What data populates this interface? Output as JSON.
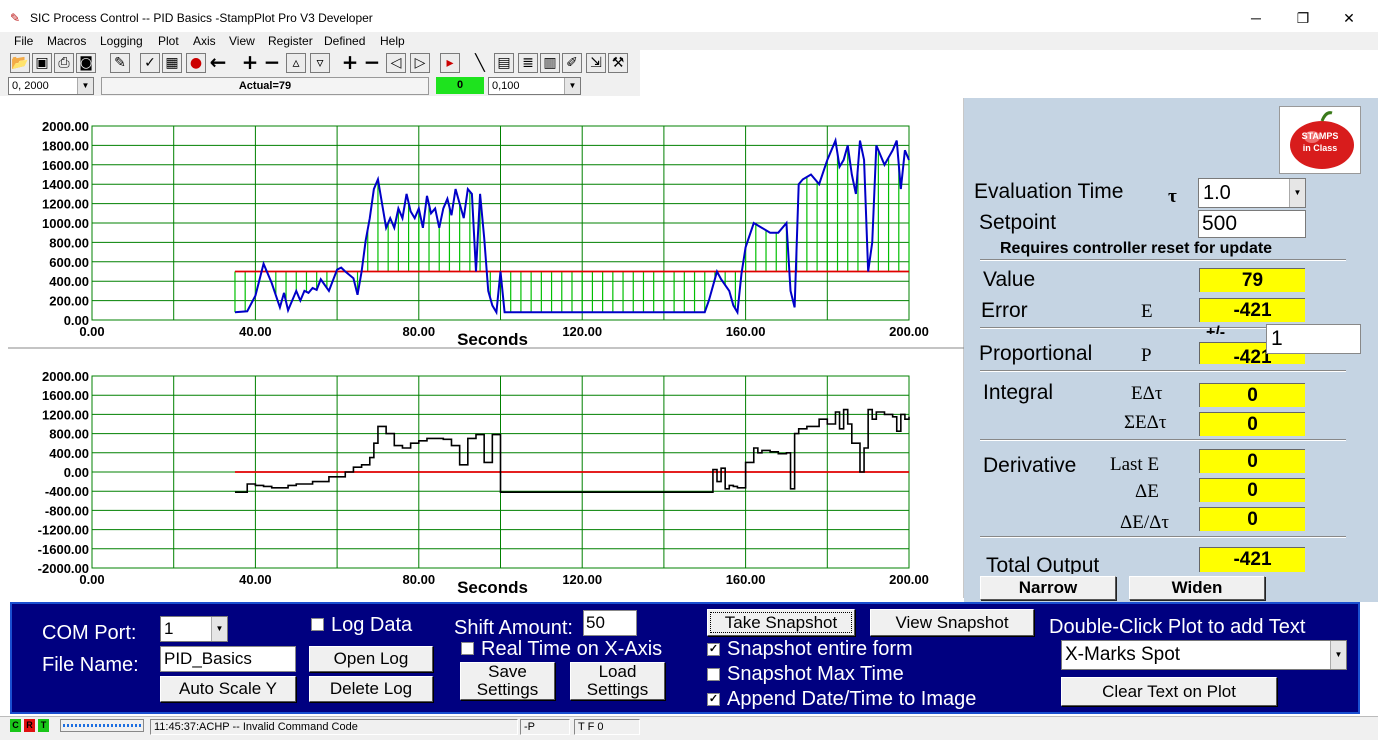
{
  "window": {
    "title": "SIC Process Control -- PID Basics -StampPlot Pro V3 Developer",
    "minimize": "─",
    "restore": "❐",
    "close": "✕"
  },
  "menu": [
    "File",
    "Macros",
    "Logging",
    "Plot",
    "Axis",
    "View",
    "Register",
    "Defined",
    "Help"
  ],
  "toolbar": {
    "icons": [
      "open-icon",
      "save-icon",
      "print-icon",
      "camera-icon",
      "wand-icon",
      "stamp-icon",
      "image-icon",
      "stop-icon",
      "back-arrow-icon",
      "zoom-in-icon",
      "zoom-out-icon",
      "zoom-down-icon",
      "zoom-up-icon",
      "y-plus-icon",
      "y-minus-icon",
      "y-shift-left-icon",
      "y-shift-right-icon",
      "reset-icon",
      "pen-icon",
      "grid-icon",
      "notes-icon",
      "page-icon",
      "draw-icon",
      "export-icon",
      "config-icon"
    ]
  },
  "controls": {
    "x_range": "0, 2000",
    "actual": "Actual=79",
    "indicator": "0",
    "y_range": "0,100"
  },
  "plot1": {
    "xlabel": "Seconds",
    "xticks": [
      "0.00",
      "40.00",
      "80.00",
      "120.00",
      "160.00",
      "200.00"
    ],
    "yticks": [
      "2000.00",
      "1800.00",
      "1600.00",
      "1400.00",
      "1200.00",
      "1000.00",
      "800.00",
      "600.00",
      "400.00",
      "200.00",
      "0.00"
    ]
  },
  "plot2": {
    "xlabel": "Seconds",
    "xticks": [
      "0.00",
      "40.00",
      "80.00",
      "120.00",
      "160.00",
      "200.00"
    ],
    "yticks": [
      "2000.00",
      "1600.00",
      "1200.00",
      "800.00",
      "400.00",
      "0.00",
      "-400.00",
      "-800.00",
      "-1200.00",
      "-1600.00",
      "-2000.00"
    ]
  },
  "chart_data": [
    {
      "type": "line",
      "xlabel": "Seconds",
      "ylabel": "",
      "xlim": [
        0,
        200
      ],
      "ylim": [
        0,
        2000
      ],
      "setpoint": 500,
      "colors": {
        "value": "#0000c8",
        "setpoint": "#e00000",
        "error": "#00c000"
      },
      "series": [
        {
          "x": [
            35,
            38,
            40,
            42,
            44,
            46,
            47,
            48,
            50,
            51,
            52,
            53,
            54,
            55,
            56,
            58,
            60,
            61,
            62,
            64,
            65,
            66,
            67,
            68,
            69,
            70,
            71,
            72,
            73,
            74,
            75,
            76,
            77,
            78,
            79,
            80,
            81,
            82,
            83,
            84,
            85,
            86,
            87,
            88,
            89,
            90,
            91,
            92,
            93,
            94,
            95,
            96,
            97,
            98,
            99,
            100,
            101,
            110,
            120,
            130,
            140,
            148,
            150,
            151,
            152,
            153,
            154,
            156,
            157,
            158,
            159,
            160,
            162,
            164,
            166,
            168,
            170,
            171,
            172,
            173,
            174,
            176,
            178,
            180,
            182,
            183,
            184,
            185,
            186,
            187,
            188,
            189,
            190,
            191,
            192,
            194,
            196,
            197,
            198,
            199,
            200
          ],
          "y": [
            80,
            90,
            250,
            580,
            380,
            130,
            280,
            100,
            300,
            200,
            300,
            280,
            330,
            310,
            420,
            300,
            520,
            540,
            500,
            430,
            260,
            500,
            820,
            1050,
            1350,
            1450,
            1200,
            950,
            1050,
            950,
            1150,
            1050,
            1300,
            1120,
            1050,
            1150,
            950,
            1280,
            1100,
            1150,
            950,
            1150,
            1250,
            1080,
            1350,
            1200,
            1050,
            1350,
            1300,
            500,
            1300,
            850,
            300,
            150,
            80,
            500,
            80,
            80,
            80,
            80,
            80,
            80,
            80,
            200,
            350,
            500,
            420,
            300,
            150,
            80,
            480,
            750,
            1000,
            950,
            900,
            900,
            1000,
            300,
            130,
            1400,
            1450,
            1500,
            1400,
            1650,
            1850,
            1580,
            1650,
            1800,
            1500,
            1300,
            1850,
            1650,
            500,
            800,
            1800,
            1600,
            1750,
            1850,
            1350,
            1750,
            1650
          ]
        },
        {
          "x": [
            35,
            200
          ],
          "y": [
            500,
            500
          ]
        }
      ]
    },
    {
      "type": "line",
      "xlabel": "Seconds",
      "ylabel": "",
      "xlim": [
        0,
        200
      ],
      "ylim": [
        -2000,
        2000
      ],
      "colors": {
        "output": "#000000",
        "zero": "#e00000"
      },
      "series": [
        {
          "x": [
            35,
            38,
            40,
            42,
            44,
            48,
            50,
            52,
            54,
            58,
            62,
            64,
            66,
            68,
            69,
            70,
            72,
            74,
            76,
            78,
            80,
            82,
            84,
            86,
            88,
            90,
            92,
            94,
            95,
            96,
            98,
            100,
            101,
            110,
            120,
            130,
            140,
            150,
            152,
            153,
            154,
            155,
            156,
            157,
            158,
            160,
            162,
            163,
            164,
            166,
            168,
            170,
            171,
            172,
            173,
            175,
            178,
            180,
            182,
            183,
            184,
            185,
            186,
            188,
            189,
            190,
            191,
            192,
            194,
            196,
            197,
            198,
            199,
            200
          ],
          "y": [
            -421,
            -250,
            -280,
            -300,
            -330,
            -280,
            -250,
            -250,
            -200,
            -100,
            0,
            100,
            150,
            300,
            600,
            950,
            800,
            550,
            500,
            600,
            650,
            700,
            700,
            680,
            550,
            150,
            700,
            780,
            780,
            200,
            780,
            -421,
            -421,
            -421,
            -421,
            -421,
            -421,
            -421,
            50,
            -200,
            80,
            -350,
            -280,
            -300,
            -330,
            200,
            500,
            400,
            450,
            420,
            380,
            400,
            -350,
            800,
            900,
            950,
            1100,
            1000,
            1250,
            900,
            1300,
            1000,
            600,
            0,
            500,
            1300,
            1100,
            1250,
            1200,
            1150,
            850,
            1200,
            1100,
            1150
          ]
        },
        {
          "x": [
            35,
            200
          ],
          "y": [
            0,
            0
          ]
        }
      ]
    }
  ],
  "right": {
    "eval_label": "Evaluation Time",
    "tau": "τ",
    "eval_value": "1.0",
    "setpoint_label": "Setpoint",
    "setpoint_value": "500",
    "reset_note": "Requires controller reset for update",
    "value_label": "Value",
    "value": "79",
    "error_label": "Error",
    "error_sym": "E",
    "error": "-421",
    "pm_label": "+/-",
    "kp": "1",
    "prop_label": "Proportional",
    "prop_sym": "P",
    "prop": "-421",
    "integral_label": "Integral",
    "edt_sym": "EΔτ",
    "edt": "0",
    "sum_sym": "ΣEΔτ",
    "sum": "0",
    "deriv_label": "Derivative",
    "laste_sym": "Last E",
    "laste": "0",
    "de_sym": "ΔE",
    "de": "0",
    "dedt_sym": "ΔE/Δτ",
    "dedt": "0",
    "total_label": "Total Output",
    "total": "-421",
    "narrow": "Narrow",
    "widen": "Widen",
    "logo_top": "STAMPS",
    "logo_mid": "in Class"
  },
  "bottom": {
    "com_label": "COM Port:",
    "com_value": "1",
    "file_label": "File Name:",
    "file_value": "PID_Basics",
    "autoscale": "Auto Scale Y",
    "logdata": "Log Data",
    "openlog": "Open Log",
    "deletelog": "Delete Log",
    "shift_label": "Shift Amount:",
    "shift_value": "50",
    "realtime": "Real Time on X-Axis",
    "save1": "Save",
    "save2": "Settings",
    "load1": "Load",
    "load2": "Settings",
    "take": "Take Snapshot",
    "view": "View Snapshot",
    "snap_form": "Snapshot entire form",
    "snap_max": "Snapshot Max Time",
    "append": "Append Date/Time to Image",
    "dbl_label": "Double-Click Plot to add Text",
    "marks": "X-Marks Spot",
    "clear": "Clear Text on Plot"
  },
  "status": {
    "c": "C",
    "r": "R",
    "t": "T",
    "msg": "11:45:37:ACHP -- Invalid Command Code",
    "p": "-P",
    "tf": "T F 0"
  }
}
